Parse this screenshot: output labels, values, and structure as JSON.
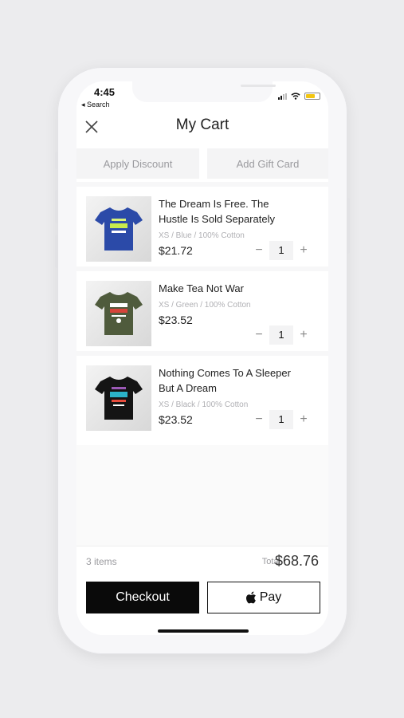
{
  "status_bar": {
    "time": "4:45",
    "back_label": "◂ Search"
  },
  "header": {
    "title": "My Cart"
  },
  "actions": {
    "apply_discount": "Apply Discount",
    "add_gift_card": "Add Gift Card"
  },
  "cart_items": [
    {
      "name": "The Dream Is Free. The Hustle Is Sold Separately",
      "variant": "XS / Blue / 100% Cotton",
      "price": "$21.72",
      "qty": "1",
      "shirt_color": "#2b4aa8"
    },
    {
      "name": "Make Tea Not War",
      "variant": "XS / Green / 100% Cotton",
      "price": "$23.52",
      "qty": "1",
      "shirt_color": "#4f5b3c"
    },
    {
      "name": "Nothing Comes To A Sleeper But A Dream",
      "variant": "XS / Black / 100% Cotton",
      "price": "$23.52",
      "qty": "1",
      "shirt_color": "#141414"
    }
  ],
  "footer": {
    "item_count": "3 items",
    "total_label": "Total",
    "total_value": "$68.76",
    "checkout_label": "Checkout",
    "applepay_label": "Pay"
  },
  "colors": {
    "accent": "#0a0a0a",
    "battery": "#f2c511"
  }
}
